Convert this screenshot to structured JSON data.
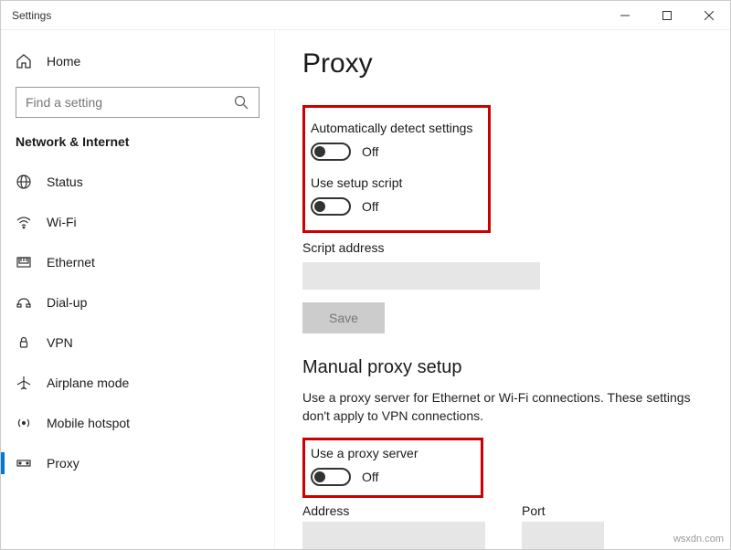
{
  "window": {
    "title": "Settings"
  },
  "sidebar": {
    "home_label": "Home",
    "search_placeholder": "Find a setting",
    "group_label": "Network & Internet",
    "items": [
      {
        "label": "Status"
      },
      {
        "label": "Wi-Fi"
      },
      {
        "label": "Ethernet"
      },
      {
        "label": "Dial-up"
      },
      {
        "label": "VPN"
      },
      {
        "label": "Airplane mode"
      },
      {
        "label": "Mobile hotspot"
      },
      {
        "label": "Proxy"
      }
    ]
  },
  "page": {
    "title": "Proxy",
    "auto_detect_label": "Automatically detect settings",
    "auto_detect_state": "Off",
    "use_script_label": "Use setup script",
    "use_script_state": "Off",
    "script_address_label": "Script address",
    "script_address_value": "",
    "save_label": "Save",
    "manual_title": "Manual proxy setup",
    "manual_desc": "Use a proxy server for Ethernet or Wi-Fi connections. These settings don't apply to VPN connections.",
    "use_proxy_label": "Use a proxy server",
    "use_proxy_state": "Off",
    "address_label": "Address",
    "address_value": "",
    "port_label": "Port",
    "port_value": ""
  },
  "watermark": "wsxdn.com"
}
